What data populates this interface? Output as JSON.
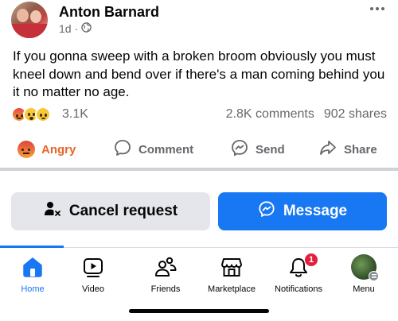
{
  "post": {
    "author": "Anton Barnard",
    "time": "1d",
    "separator": "·",
    "text": "If you gonna sweep with a broken broom obviously you must kneel down and bend over if there's a man coming behind you it no matter no age.",
    "reactions": [
      "angry",
      "wow",
      "sad"
    ],
    "reaction_count": "3.1K",
    "comments": "2.8K comments",
    "shares": "902 shares"
  },
  "actions": {
    "angry_label": "Angry",
    "comment_label": "Comment",
    "send_label": "Send",
    "share_label": "Share"
  },
  "profile_buttons": {
    "cancel_label": "Cancel request",
    "message_label": "Message"
  },
  "tabs": [
    {
      "label": "Home",
      "icon": "home-icon",
      "active": true
    },
    {
      "label": "Video",
      "icon": "video-icon"
    },
    {
      "label": "Friends",
      "icon": "friends-icon"
    },
    {
      "label": "Marketplace",
      "icon": "marketplace-icon"
    },
    {
      "label": "Notifications",
      "icon": "bell-icon",
      "badge": "1"
    },
    {
      "label": "Menu",
      "icon": "menu-avatar"
    }
  ],
  "colors": {
    "accent": "#1877f2",
    "angry": "#e8642b",
    "badge": "#e41e3f",
    "secondary_text": "#65676b"
  }
}
